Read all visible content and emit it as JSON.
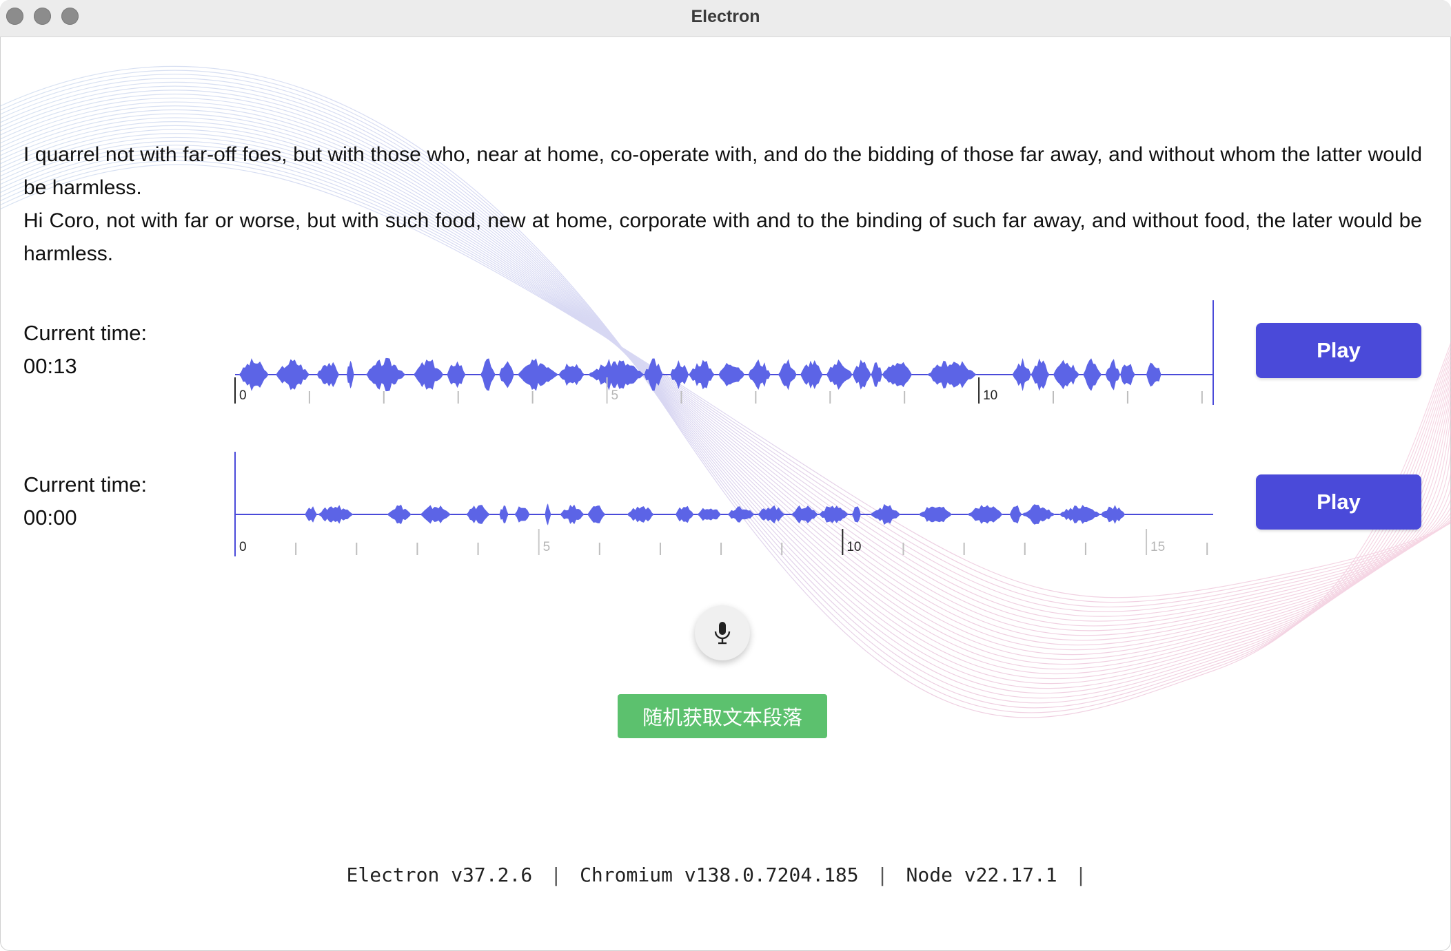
{
  "window": {
    "title": "Electron"
  },
  "passage": {
    "reference": "I quarrel not with far-off foes, but with those who, near at home, co-operate with, and do the bidding of those far away, and without whom the latter would be harmless.",
    "transcript": "Hi Coro, not with far or worse, but with such food, new at home, corporate with and to the binding of such far away, and without food, the later would be harmless."
  },
  "players": [
    {
      "time_label": "Current time:",
      "time_value": "00:13",
      "play_label": "Play",
      "duration_seconds": 13.15,
      "ticks": [
        "0",
        "5",
        "10"
      ],
      "progress": 1.0
    },
    {
      "time_label": "Current time:",
      "time_value": "00:00",
      "play_label": "Play",
      "duration_seconds": 16.1,
      "ticks": [
        "0",
        "5",
        "10",
        "15"
      ],
      "progress": 0.0
    }
  ],
  "mic": {
    "icon": "microphone-icon"
  },
  "random_button": {
    "label": "随机获取文本段落"
  },
  "versions": {
    "electron": "Electron v37.2.6",
    "chromium": "Chromium v138.0.7204.185",
    "node": "Node v22.17.1",
    "separator": "|"
  },
  "colors": {
    "accent": "#4a4ad9",
    "waveform": "#5c64e6",
    "green": "#5cc16e"
  }
}
